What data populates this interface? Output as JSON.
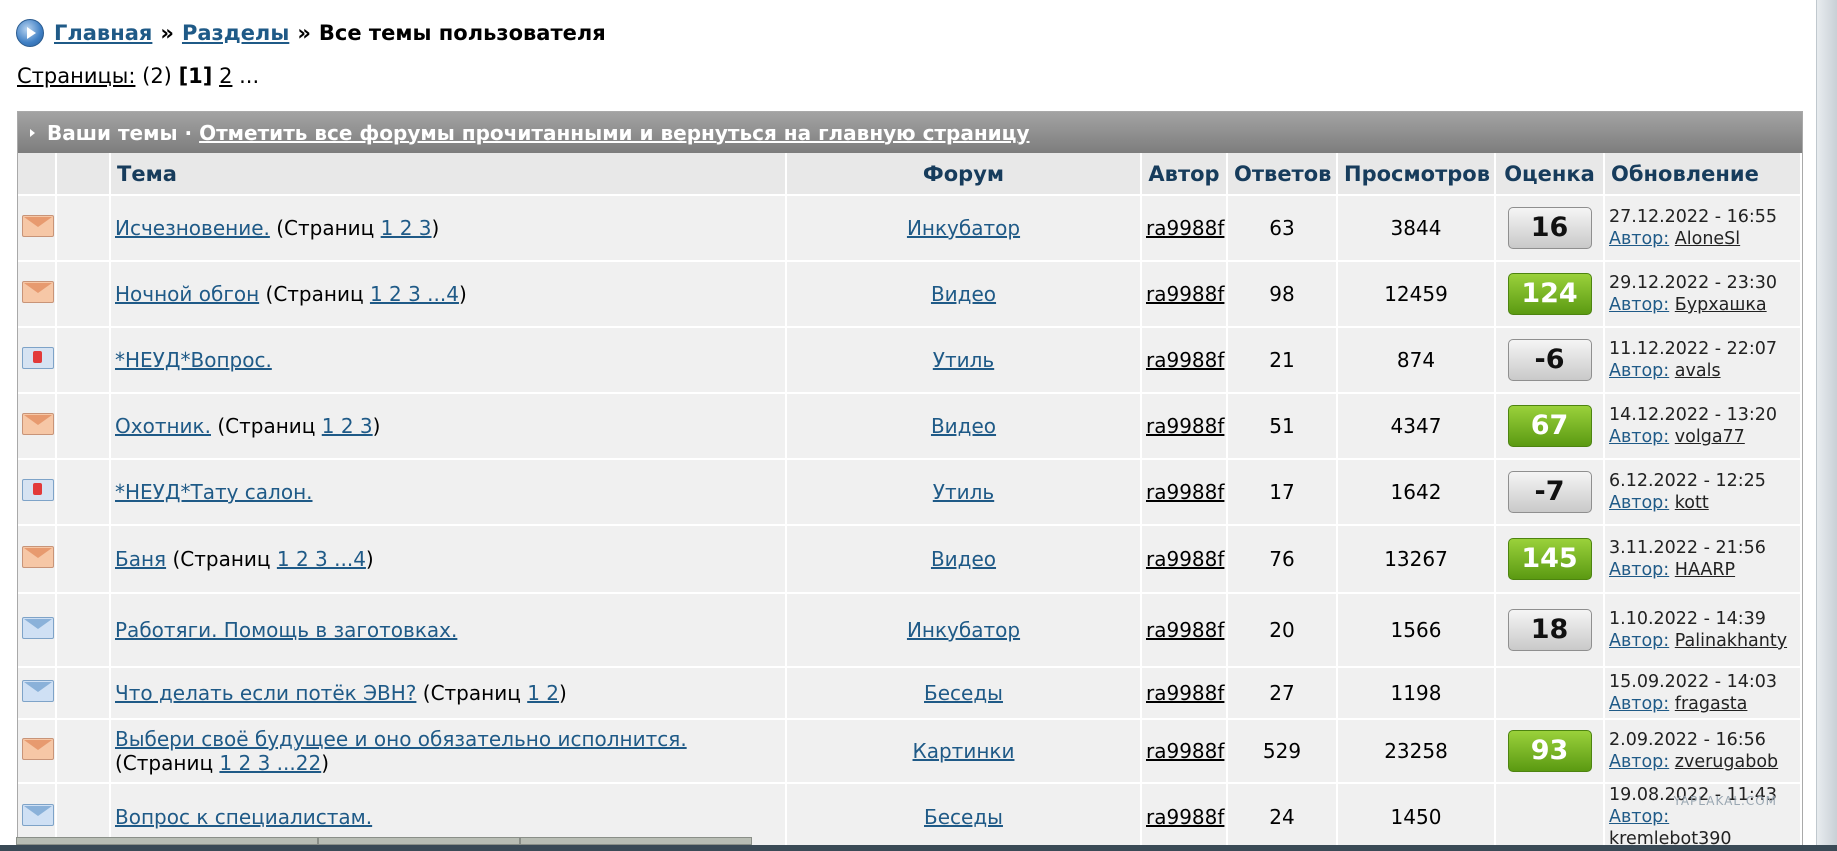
{
  "breadcrumb": {
    "home": "Главная",
    "sep1": "»",
    "sections": "Разделы",
    "sep2": "»",
    "current": "Все темы пользователя"
  },
  "pagination": {
    "label": "Страницы:",
    "total": "(2)",
    "current": "[1]",
    "next": "2",
    "more": "..."
  },
  "table": {
    "header_title": "Ваши темы ·",
    "header_link": "Отметить все форумы прочитанными и вернуться на главную страницу",
    "columns": [
      "Тема",
      "Форум",
      "Автор",
      "Ответов",
      "Просмотров",
      "Оценка",
      "Обновление"
    ],
    "rows": [
      {
        "icon": "envelope-orange",
        "title": "Исчезновение.",
        "pages": "1 2 3",
        "forum": "Инкубатор",
        "author": "ra9988f",
        "replies": "63",
        "views": "3844",
        "rating": "16",
        "rating_style": "grey",
        "upd_date": "27.12.2022 - 16:55",
        "upd_label": "Автор:",
        "upd_user": "AloneSl"
      },
      {
        "icon": "envelope-orange",
        "title": "Ночной обгон",
        "pages": "1 2 3 ...4",
        "forum": "Видео",
        "author": "ra9988f",
        "replies": "98",
        "views": "12459",
        "rating": "124",
        "rating_style": "green",
        "upd_date": "29.12.2022 - 23:30",
        "upd_label": "Автор:",
        "upd_user": "Бурхашка"
      },
      {
        "icon": "envelope-locked",
        "title": "*НЕУД*Вопрос.",
        "pages": "",
        "forum": "Утиль",
        "author": "ra9988f",
        "replies": "21",
        "views": "874",
        "rating": "-6",
        "rating_style": "grey",
        "upd_date": "11.12.2022 - 22:07",
        "upd_label": "Автор:",
        "upd_user": "avals"
      },
      {
        "icon": "envelope-orange",
        "title": "Охотник.",
        "pages": "1 2 3",
        "forum": "Видео",
        "author": "ra9988f",
        "replies": "51",
        "views": "4347",
        "rating": "67",
        "rating_style": "green",
        "upd_date": "14.12.2022 - 13:20",
        "upd_label": "Автор:",
        "upd_user": "volga77"
      },
      {
        "icon": "envelope-locked",
        "title": "*НЕУД*Тату салон.",
        "pages": "",
        "forum": "Утиль",
        "author": "ra9988f",
        "replies": "17",
        "views": "1642",
        "rating": "-7",
        "rating_style": "grey",
        "upd_date": "6.12.2022 - 12:25",
        "upd_label": "Автор:",
        "upd_user": "kott"
      },
      {
        "icon": "envelope-orange",
        "title": "Баня",
        "pages": "1 2 3 ...4",
        "forum": "Видео",
        "author": "ra9988f",
        "replies": "76",
        "views": "13267",
        "rating": "145",
        "rating_style": "green",
        "upd_date": "3.11.2022 - 21:56",
        "upd_label": "Автор:",
        "upd_user": "HAARP"
      },
      {
        "icon": "envelope-blue",
        "title": "Работяги. Помощь в заготовках.",
        "pages": "",
        "forum": "Инкубатор",
        "author": "ra9988f",
        "replies": "20",
        "views": "1566",
        "rating": "18",
        "rating_style": "grey",
        "upd_date": "1.10.2022 - 14:39",
        "upd_label": "Автор:",
        "upd_user": "Palinakhanty"
      },
      {
        "icon": "envelope-blue",
        "title": "Что делать если потёк ЭВН?",
        "pages": "1 2",
        "forum": "Беседы",
        "author": "ra9988f",
        "replies": "27",
        "views": "1198",
        "rating": "",
        "rating_style": "none",
        "upd_date": "15.09.2022 - 14:03",
        "upd_label": "Автор:",
        "upd_user": "fragasta"
      },
      {
        "icon": "envelope-orange",
        "title": "Выбери своё будущее и оно обязательно исполнится.",
        "pages": "1 2 3 ...22",
        "forum": "Картинки",
        "author": "ra9988f",
        "replies": "529",
        "views": "23258",
        "rating": "93",
        "rating_style": "green",
        "upd_date": "2.09.2022 - 16:56",
        "upd_label": "Автор:",
        "upd_user": "zverugabob"
      },
      {
        "icon": "envelope-blue",
        "title": "Вопрос к специалистам.",
        "pages": "",
        "forum": "Беседы",
        "author": "ra9988f",
        "replies": "24",
        "views": "1450",
        "rating": "",
        "rating_style": "none",
        "upd_date": "19.08.2022 - 11:43",
        "upd_label": "Автор:",
        "upd_user": "kremlebot390"
      }
    ],
    "pages_prefix": "(Страниц",
    "pages_suffix": ")"
  },
  "watermark": "YAPLAKAL.COM"
}
